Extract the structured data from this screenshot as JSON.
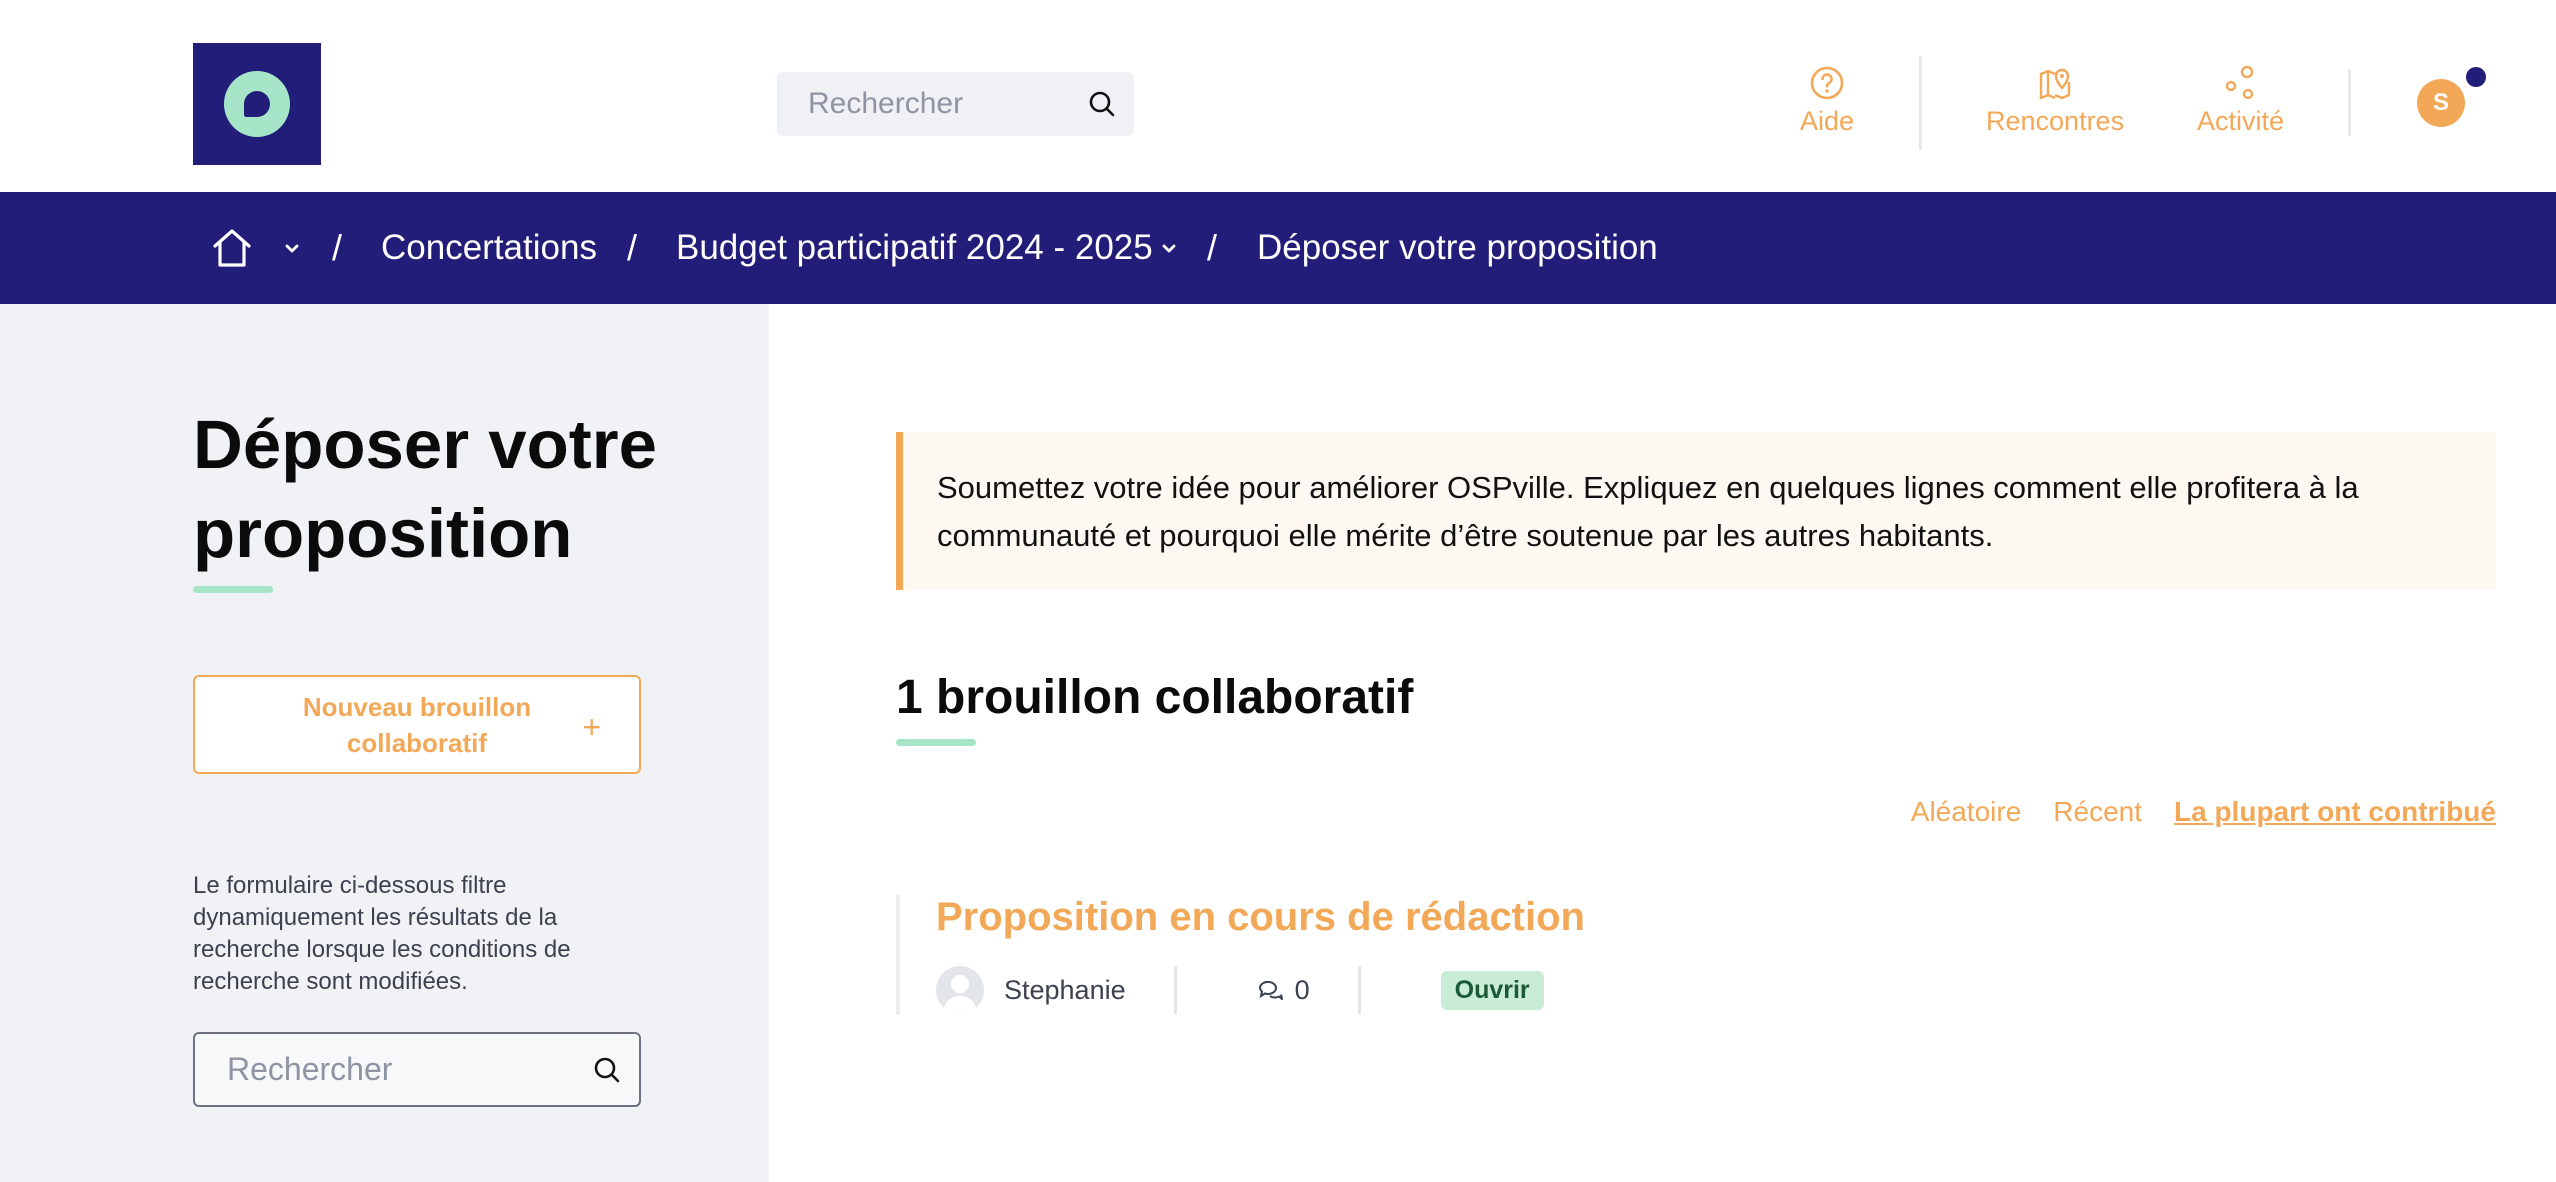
{
  "header": {
    "search_placeholder": "Rechercher",
    "nav": {
      "aide": "Aide",
      "rencontres": "Rencontres",
      "activite": "Activité"
    },
    "avatar_initial": "S"
  },
  "breadcrumb": {
    "separator": "/",
    "items": [
      "Concertations",
      "Budget participatif 2024 - 2025",
      "Déposer votre proposition"
    ]
  },
  "sidebar": {
    "title": "Déposer votre proposition",
    "new_draft_button": "Nouveau brouillon collaboratif",
    "new_draft_icon": "+",
    "filter_description": "Le formulaire ci-dessous filtre dynamiquement les résultats de la recherche lorsque les conditions de recherche sont modifiées.",
    "search_placeholder": "Rechercher"
  },
  "main": {
    "callout": "Soumettez votre idée pour améliorer OSPville. Expliquez en quelques lignes comment elle profitera à la communauté et pourquoi elle mérite d’être soutenue par les autres habitants.",
    "section_title": "1 brouillon collaboratif",
    "sort": {
      "random": "Aléatoire",
      "recent": "Récent",
      "most_contributed": "La plupart ont contribué"
    },
    "drafts": [
      {
        "title": "Proposition en cours de rédaction",
        "author": "Stephanie",
        "comments": "0",
        "status": "Ouvrir"
      }
    ]
  },
  "colors": {
    "brand": "#231d7a",
    "accent": "#f3a857",
    "mint": "#a6e5c8"
  }
}
